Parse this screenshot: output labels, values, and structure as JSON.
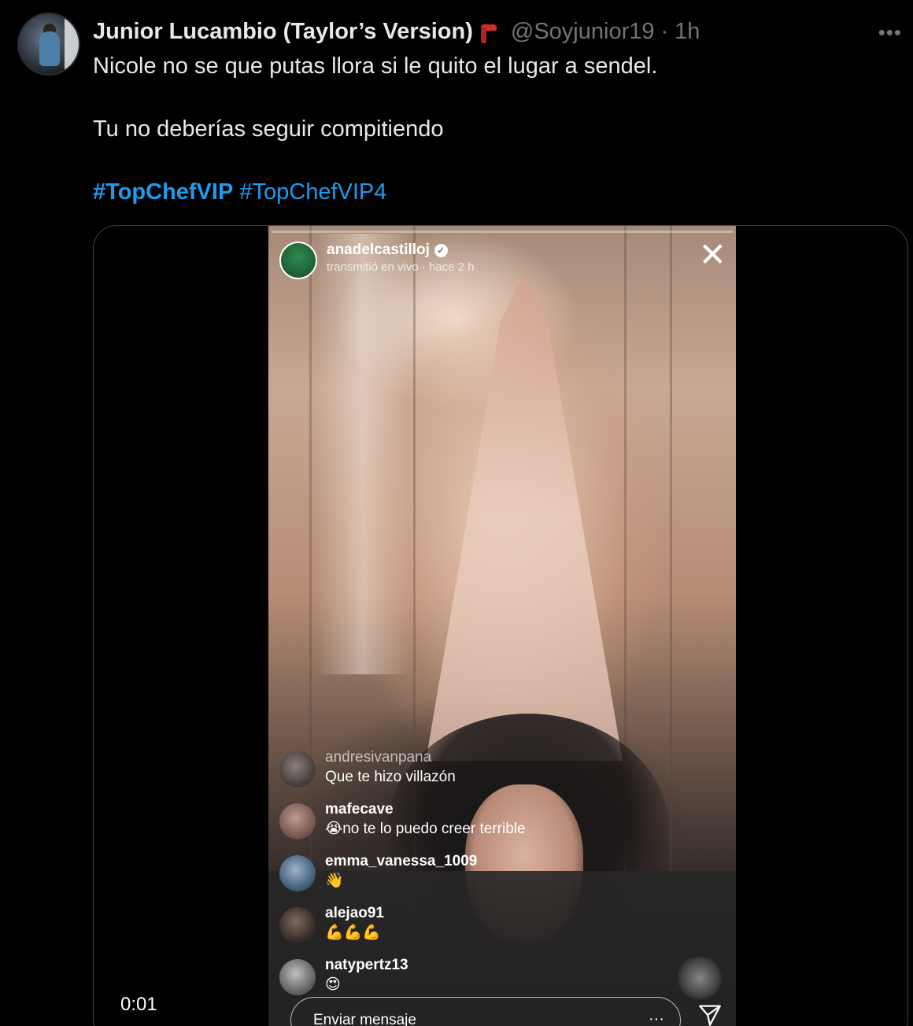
{
  "tweet": {
    "display_name": "Junior Lucambio (Taylor’s Version)",
    "handle": "@Soyjunior19",
    "separator": "·",
    "time": "1h",
    "more_icon": "more-horizontal-icon",
    "text_line1": "Nicole no se que putas llora si le quito el lugar a sendel.",
    "text_line2": "Tu no deberías seguir compitiendo",
    "hashtags": [
      "#TopChefVIP",
      "#TopChefVIP4"
    ],
    "colors": {
      "background": "#000000",
      "link": "#1d9bf0",
      "secondary": "#71767b",
      "text": "#e7e9ea"
    }
  },
  "media": {
    "type": "video",
    "timestamp": "0:01",
    "instagram_live": {
      "username": "anadelcastilloj",
      "subtitle": "transmitió en vivo · hace 2 h",
      "close_icon": "close-icon",
      "comments": [
        {
          "user": "andresivanpana",
          "text": "Que te hizo villazón"
        },
        {
          "user": "mafecave",
          "text": "😭no te lo puedo creer terrible"
        },
        {
          "user": "emma_vanessa_1009",
          "text": "👋"
        },
        {
          "user": "alejao91",
          "text": "💪💪💪"
        },
        {
          "user": "natypertz13",
          "text": "😍"
        }
      ],
      "input_placeholder": "Enviar mensaje",
      "input_more": "···"
    }
  }
}
